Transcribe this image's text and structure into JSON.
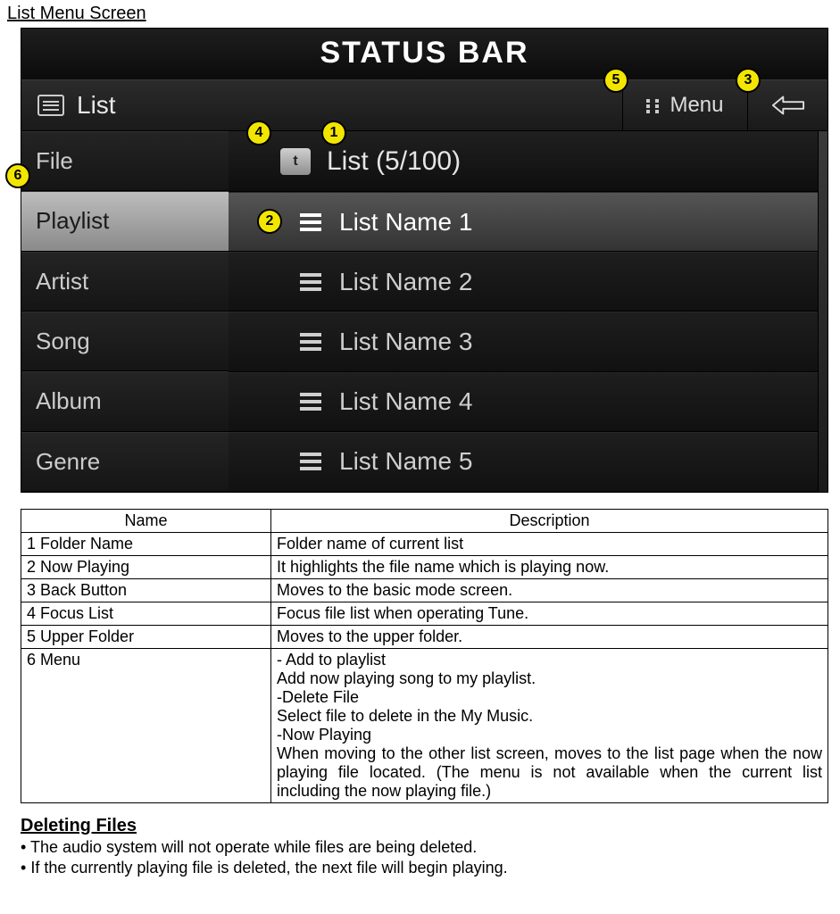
{
  "section_title": "List Menu Screen",
  "device": {
    "status_bar": "STATUS BAR",
    "top": {
      "list_label": "List",
      "menu_label": "Menu"
    },
    "sidebar": {
      "items": [
        {
          "label": "File"
        },
        {
          "label": "Playlist"
        },
        {
          "label": "Artist"
        },
        {
          "label": "Song"
        },
        {
          "label": "Album"
        },
        {
          "label": "Genre"
        }
      ],
      "selected_index": 1
    },
    "list": {
      "header": "List (5/100)",
      "rows": [
        {
          "label": "List Name 1"
        },
        {
          "label": "List Name 2"
        },
        {
          "label": "List Name 3"
        },
        {
          "label": "List Name 4"
        },
        {
          "label": "List Name 5"
        }
      ],
      "playing_index": 0
    }
  },
  "callouts": {
    "c1": "1",
    "c2": "2",
    "c3": "3",
    "c4": "4",
    "c5": "5",
    "c6": "6"
  },
  "table": {
    "headers": {
      "name": "Name",
      "desc": "Description"
    },
    "rows": [
      {
        "name": "1 Folder Name",
        "desc": "Folder name of current list"
      },
      {
        "name": "2 Now Playing",
        "desc": "It highlights the file name which is playing now."
      },
      {
        "name": "3 Back Button",
        "desc": "Moves to the basic mode screen."
      },
      {
        "name": "4 Focus List",
        "desc": "Focus file list when operating Tune."
      },
      {
        "name": "5 Upper Folder",
        "desc": "Moves to the upper folder."
      }
    ],
    "menu_row": {
      "name": "6 Menu",
      "lines": [
        "- Add to playlist",
        "Add now playing song to my playlist.",
        "-Delete File",
        "Select file to delete in the My Music.",
        "-Now Playing",
        "When moving to the other list screen, moves to the list page when the now playing file located. (The menu is not available when the current list including the now playing file.)"
      ]
    }
  },
  "deleting": {
    "title": "Deleting Files",
    "bullets": [
      "The audio system will not operate while files are being deleted.",
      "If the currently playing file is deleted, the next file will begin playing."
    ]
  }
}
